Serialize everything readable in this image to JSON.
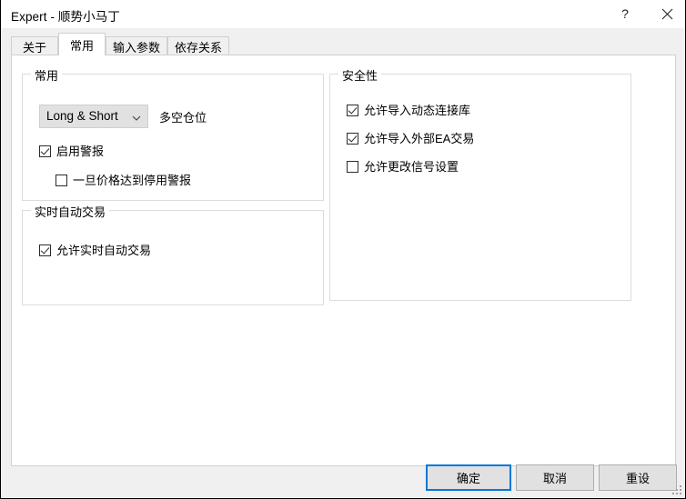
{
  "window": {
    "title": "Expert - 顺势小马丁",
    "help_button": "?",
    "close_button": "close-icon"
  },
  "tabs": [
    {
      "label": "关于",
      "selected": false
    },
    {
      "label": "常用",
      "selected": true
    },
    {
      "label": "输入参数",
      "selected": false
    },
    {
      "label": "依存关系",
      "selected": false
    }
  ],
  "groups": {
    "common": {
      "label": "常用",
      "combo": {
        "value": "Long & Short",
        "side_label": "多空仓位"
      },
      "checkboxes": [
        {
          "label": "启用警报",
          "checked": true
        },
        {
          "label": "一旦价格达到停用警报",
          "checked": false
        }
      ]
    },
    "realtime": {
      "label": "实时自动交易",
      "checkboxes": [
        {
          "label": "允许实时自动交易",
          "checked": true
        }
      ]
    },
    "security": {
      "label": "安全性",
      "checkboxes": [
        {
          "label": "允许导入动态连接库",
          "checked": true
        },
        {
          "label": "允许导入外部EA交易",
          "checked": true
        },
        {
          "label": "允许更改信号设置",
          "checked": false
        }
      ]
    }
  },
  "buttons": {
    "ok": "确定",
    "cancel": "取消",
    "reset": "重设"
  },
  "colors": {
    "focus_accent": "#0078d7",
    "dialog_background": "#f0f0f0",
    "panel_background": "#ffffff",
    "group_border": "#dcdcdc",
    "button_face": "#e1e1e1"
  }
}
